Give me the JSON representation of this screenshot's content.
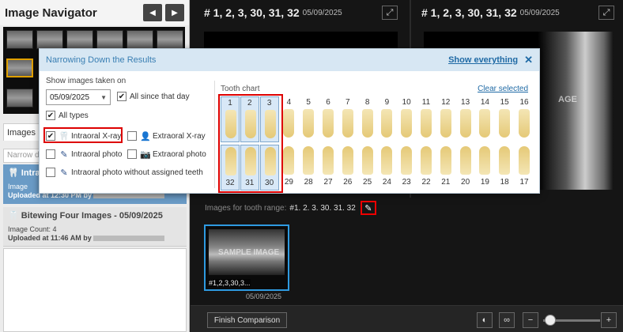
{
  "navigator": {
    "title": "Image Navigator",
    "prev": "◀",
    "next": "▶",
    "tab_images": "Images",
    "narrow_placeholder": "Narrow do",
    "groups": [
      {
        "title": "Intra",
        "count_label": "Image",
        "uploaded": "Uploaded at 12:30 PM by"
      },
      {
        "title": "Bitewing Four Images - 05/09/2025",
        "count_label": "Image Count: 4",
        "uploaded": "Uploaded at 11:46 AM by"
      }
    ]
  },
  "viewer": {
    "left_title": "# 1, 2, 3, 30, 31, 32",
    "left_date": "05/09/2025",
    "right_title": "# 1, 2, 3, 30, 31, 32",
    "right_date": "05/09/2025",
    "range_label": "Images for tooth range:",
    "range_value": "#1. 2. 3. 30. 31. 32",
    "result_caption": "#1,2,3,30,3...",
    "result_watermark": "SAMPLE IMAGE",
    "result_date": "05/09/2025",
    "finish_label": "Finish Comparison",
    "watermark_right": "AGE"
  },
  "popup": {
    "title": "Narrowing Down the Results",
    "show_everything": "Show everything",
    "taken_on_label": "Show images taken on",
    "date_value": "05/09/2025",
    "all_since_label": "All since that day",
    "all_types_label": "All types",
    "types": [
      {
        "label": "Intraoral X-ray",
        "checked": true
      },
      {
        "label": "Extraoral X-ray",
        "checked": false
      },
      {
        "label": "Intraoral photo",
        "checked": false
      },
      {
        "label": "Extraoral photo",
        "checked": false
      },
      {
        "label": "Intraoral photo without assigned teeth",
        "checked": false
      }
    ],
    "tooth_chart_label": "Tooth chart",
    "clear_selected": "Clear selected",
    "upper_teeth": [
      "1",
      "2",
      "3",
      "4",
      "5",
      "6",
      "7",
      "8",
      "9",
      "10",
      "11",
      "12",
      "13",
      "14",
      "15",
      "16"
    ],
    "lower_teeth": [
      "32",
      "31",
      "30",
      "29",
      "28",
      "27",
      "26",
      "25",
      "24",
      "23",
      "22",
      "21",
      "20",
      "19",
      "18",
      "17"
    ],
    "selected_upper": [
      "1",
      "2",
      "3"
    ],
    "selected_lower": [
      "32",
      "31",
      "30"
    ]
  },
  "colors": {
    "accent": "#1f6aa5",
    "highlight": "#dd0000",
    "selected_group": "#6a9bc6"
  },
  "icons": [
    "prev-icon",
    "next-icon",
    "tooth-icon",
    "expand-icon",
    "pencil-icon",
    "close-icon",
    "camera-icon",
    "person-icon",
    "contrast-icon",
    "link-icon",
    "minus-icon",
    "plus-icon"
  ]
}
